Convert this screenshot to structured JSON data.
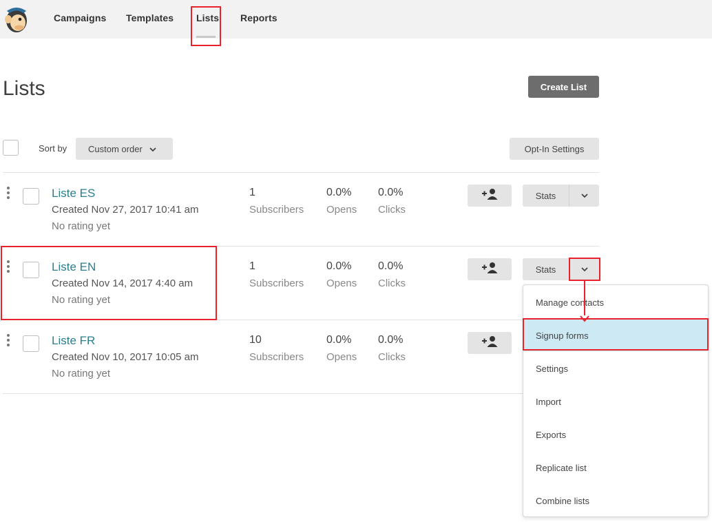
{
  "nav": {
    "items": [
      "Campaigns",
      "Templates",
      "Lists",
      "Reports"
    ],
    "active": "Lists"
  },
  "header": {
    "title": "Lists",
    "create_label": "Create List"
  },
  "toolbar": {
    "sort_label": "Sort by",
    "sort_value": "Custom order",
    "optin_label": "Opt-In Settings"
  },
  "lists": [
    {
      "name": "Liste ES",
      "created": "Created Nov 27, 2017 10:41 am",
      "rating": "No rating yet",
      "subscribers": "1",
      "subscribers_label": "Subscribers",
      "opens": "0.0%",
      "opens_label": "Opens",
      "clicks": "0.0%",
      "clicks_label": "Clicks",
      "stats_label": "Stats"
    },
    {
      "name": "Liste EN",
      "created": "Created Nov 14, 2017 4:40 am",
      "rating": "No rating yet",
      "subscribers": "1",
      "subscribers_label": "Subscribers",
      "opens": "0.0%",
      "opens_label": "Opens",
      "clicks": "0.0%",
      "clicks_label": "Clicks",
      "stats_label": "Stats"
    },
    {
      "name": "Liste FR",
      "created": "Created Nov 10, 2017 10:05 am",
      "rating": "No rating yet",
      "subscribers": "10",
      "subscribers_label": "Subscribers",
      "opens": "0.0%",
      "opens_label": "Opens",
      "clicks": "0.0%",
      "clicks_label": "Clicks",
      "stats_label": "Stats"
    }
  ],
  "menu": {
    "items": [
      "Manage contacts",
      "Signup forms",
      "Settings",
      "Import",
      "Exports",
      "Replicate list",
      "Combine lists"
    ],
    "highlighted": "Signup forms"
  },
  "colors": {
    "accent_link": "#2a7f8e",
    "highlight_red": "#e8212b",
    "menu_active_bg": "#cde9f3",
    "primary_button": "#6d6d6d"
  }
}
